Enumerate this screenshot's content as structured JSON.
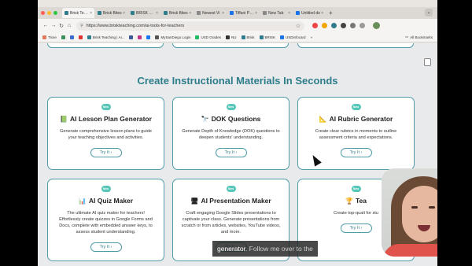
{
  "browser": {
    "tabs": [
      {
        "label": "Brisk Teachi",
        "color": "#2f7d8c",
        "active": true
      },
      {
        "label": "Brisk Bites",
        "color": "#2f7d8c"
      },
      {
        "label": "BRISK Partn",
        "color": "#2f7d8c"
      },
      {
        "label": "Brisk Bites",
        "color": "#2f7d8c"
      },
      {
        "label": "Newest Vi",
        "color": "#888888"
      },
      {
        "label": "Tiffani Prop",
        "color": "#1a73e8"
      },
      {
        "label": "New Tab",
        "color": "#888888"
      },
      {
        "label": "Untitled do",
        "color": "#1a73e8"
      }
    ],
    "new_tab_symbol": "+",
    "url": "https://www.briskteaching.com/ai-tools-for-teachers",
    "bookmarks": [
      {
        "label": "Trixie",
        "color": "#e07a5f"
      },
      {
        "label": "",
        "color": "#3c8d5a"
      },
      {
        "label": "",
        "color": "#3c6ccf"
      },
      {
        "label": "",
        "color": "#d33"
      },
      {
        "label": "Brisk Teaching | AI...",
        "color": "#2f7d8c"
      },
      {
        "label": "",
        "color": "#3b5998"
      },
      {
        "label": "",
        "color": "#c13584"
      },
      {
        "label": "",
        "color": "#1877f2"
      },
      {
        "label": "MySanDiego Login",
        "color": "#555"
      },
      {
        "label": "USD Grades",
        "color": "#2b6"
      },
      {
        "label": "NU",
        "color": "#333"
      },
      {
        "label": "Brisk",
        "color": "#2f7d8c"
      },
      {
        "label": "BRISK",
        "color": "#2f7d8c"
      },
      {
        "label": "USDinfocard",
        "color": "#1a73e8"
      }
    ],
    "all_bookmarks": "All Bookmarks"
  },
  "page": {
    "section_title": "Create Instructional Materials In Seconds",
    "badge": "New",
    "try_label": "Try It  ›",
    "cards": [
      {
        "icon": "📗",
        "title": "AI Lesson Plan Generator",
        "desc": "Generate comprehensive lesson plans to guide your teaching objectives and activities."
      },
      {
        "icon": "🔭",
        "title": "DOK Questions",
        "desc": "Generate Depth of Knowledge (DOK) questions to deepen students' understanding."
      },
      {
        "icon": "📐",
        "title": "AI Rubric Generator",
        "desc": "Create clear rubrics in moments to outline assessment criteria and expectations."
      },
      {
        "icon": "📊",
        "title": "AI Quiz Maker",
        "desc": "The ultimate AI quiz maker for teachers! Effortlessly create quizzes in Google Forms and Docs, complete with embedded answer keys, to assess student understanding."
      },
      {
        "icon": "🖥",
        "title": "AI Presentation Maker",
        "desc": "Craft engaging Google Slides presentations to captivate your class. Generate presentations from scratch or from articles, websites, YouTube videos, and more."
      },
      {
        "icon": "🏆",
        "title": "Tea",
        "desc": "Create top-quali for stu"
      }
    ]
  },
  "caption": {
    "highlight": "generator.",
    "rest": "Follow me over to the"
  }
}
